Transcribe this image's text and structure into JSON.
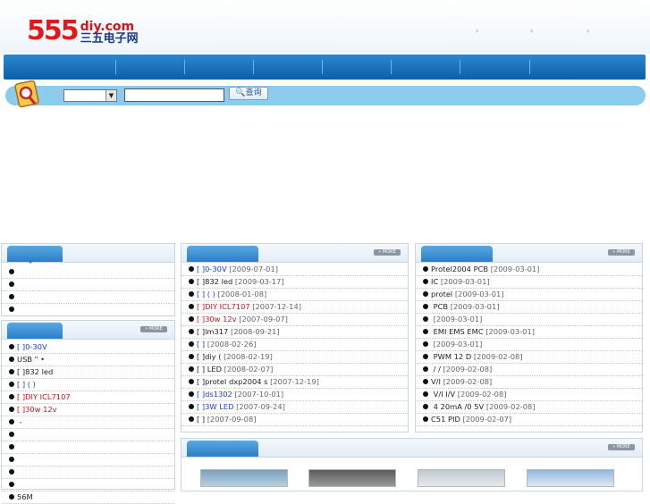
{
  "logo": {
    "number": "555",
    "domain": "diy.com",
    "cn_name": "三五电子网"
  },
  "top_links": [
    "›",
    "›",
    "›"
  ],
  "search": {
    "button_label": "查询",
    "input_value": "",
    "select_value": ""
  },
  "left_top_panel": {
    "items": [
      "",
      "",
      "",
      ""
    ]
  },
  "left_news_panel": {
    "more_label": "» MORE",
    "items": [
      {
        "text": "[ ]0-30V",
        "color": "blue"
      },
      {
        "text": "USB \" •",
        "color": "black"
      },
      {
        "text": "[ ]832 led",
        "color": "black"
      },
      {
        "text": "[ ]       (   )",
        "color": "blue"
      },
      {
        "text": "[ ]DIY    ICL7107",
        "color": "red"
      },
      {
        "text": "[ ]30w   12v",
        "color": "red"
      },
      {
        "text": "  -",
        "color": "black"
      },
      {
        "text": "",
        "color": "black"
      },
      {
        "text": "",
        "color": "black"
      },
      {
        "text": "",
        "color": "black"
      },
      {
        "text": "",
        "color": "black"
      },
      {
        "text": "",
        "color": "black"
      },
      {
        "text": "56M",
        "color": "black"
      }
    ]
  },
  "mid_panel": {
    "more_label": "» MORE",
    "items": [
      {
        "prefix": "[ ]0-30V",
        "date": "[2009-07-01]",
        "color": "blue"
      },
      {
        "prefix": "[ ]832 led",
        "date": "[2009-03-17]",
        "color": "black"
      },
      {
        "prefix": "[ ]       (   )",
        "date": "[2008-01-08]",
        "color": "blue"
      },
      {
        "prefix": "[ ]DIY    ICL7107",
        "date": "[2007-12-14]",
        "color": "red"
      },
      {
        "prefix": "[ ]30w   12v",
        "date": "[2007-09-07]",
        "color": "red"
      },
      {
        "prefix": "[ ]lm317",
        "date": "[2008-09-21]",
        "color": "black"
      },
      {
        "prefix": "[ ]",
        "date": "[2008-02-26]",
        "color": "blue"
      },
      {
        "prefix": "[ ]diy         (",
        "date": "[2008-02-19]",
        "color": "black"
      },
      {
        "prefix": "[ ]        LED",
        "date": "[2008-02-07]",
        "color": "black"
      },
      {
        "prefix": "[ ]protel dxp2004 s",
        "date": "[2007-12-19]",
        "color": "black"
      },
      {
        "prefix": "[ ]ds1302",
        "date": "[2007-10-01]",
        "color": "blue"
      },
      {
        "prefix": "[ ]3W LED",
        "date": "[2007-09-24]",
        "color": "blue"
      },
      {
        "prefix": "[ ]",
        "date": "[2007-09-08]",
        "color": "black"
      }
    ]
  },
  "right_panel": {
    "more_label": "» MORE",
    "items": [
      {
        "prefix": "Protel2004   PCB",
        "date": "[2009-03-01]"
      },
      {
        "prefix": "IC",
        "date": "[2009-03-01]"
      },
      {
        "prefix": "protel",
        "date": "[2009-03-01]"
      },
      {
        "prefix": "      PCB",
        "date": "[2009-03-01]"
      },
      {
        "prefix": "",
        "date": "[2009-03-01]"
      },
      {
        "prefix": "  EMI EMS EMC",
        "date": "[2009-03-01]"
      },
      {
        "prefix": "",
        "date": "[2009-03-01]"
      },
      {
        "prefix": "        PWM 12 D",
        "date": "[2009-02-08]"
      },
      {
        "prefix": "    /   /",
        "date": "[2009-02-08]"
      },
      {
        "prefix": "V/I",
        "date": "[2009-02-08]"
      },
      {
        "prefix": "      V/I I/V",
        "date": "[2009-02-08]"
      },
      {
        "prefix": "  4 20mA /0 5V",
        "date": "[2009-02-08]"
      },
      {
        "prefix": "C51  PID",
        "date": "[2009-02-07]"
      }
    ]
  },
  "bottom_panel": {
    "more_label": "» MORE"
  }
}
